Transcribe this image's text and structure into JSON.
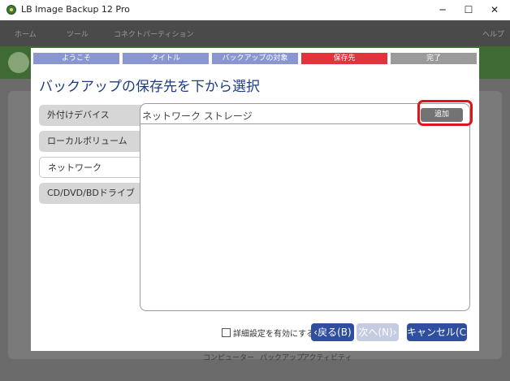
{
  "window": {
    "title": "LB Image Backup 12 Pro",
    "controls": {
      "minimize": "─",
      "maximize": "☐",
      "close": "✕"
    }
  },
  "background": {
    "tabs": [
      "ホーム",
      "ツール",
      "コネクトパーティション"
    ],
    "right_tabs": [
      "ヘルプ"
    ],
    "bottom_tabs": [
      "コンピューター",
      "バックアップ",
      "アクティビティ"
    ]
  },
  "wizard": {
    "steps": [
      {
        "label": "ようこそ",
        "state": "done"
      },
      {
        "label": "タイトル",
        "state": "done"
      },
      {
        "label": "バックアップの対象",
        "state": "done"
      },
      {
        "label": "保存先",
        "state": "current"
      },
      {
        "label": "完了",
        "state": "pending"
      }
    ],
    "step_colors": {
      "done": "#8a96cf",
      "current": "#e2343c",
      "pending": "#9a9a9a"
    },
    "heading": "バックアップの保存先を下から選択",
    "side_tabs": [
      "外付けデバイス",
      "ローカルボリューム",
      "ネットワーク",
      "CD/DVD/BDドライブ"
    ],
    "active_tab": "ネットワーク",
    "content": {
      "header": "ネットワーク ストレージ",
      "add_button": "追加"
    },
    "advanced_checkbox": {
      "label": "詳細設定を有効にする",
      "checked": false
    },
    "buttons": {
      "back": "‹戻る(B)",
      "next": "次へ(N)›",
      "cancel": "キャンセル(C)"
    },
    "button_colors": {
      "primary": "#2f4ea0",
      "disabled": "#c5cbe0"
    }
  }
}
